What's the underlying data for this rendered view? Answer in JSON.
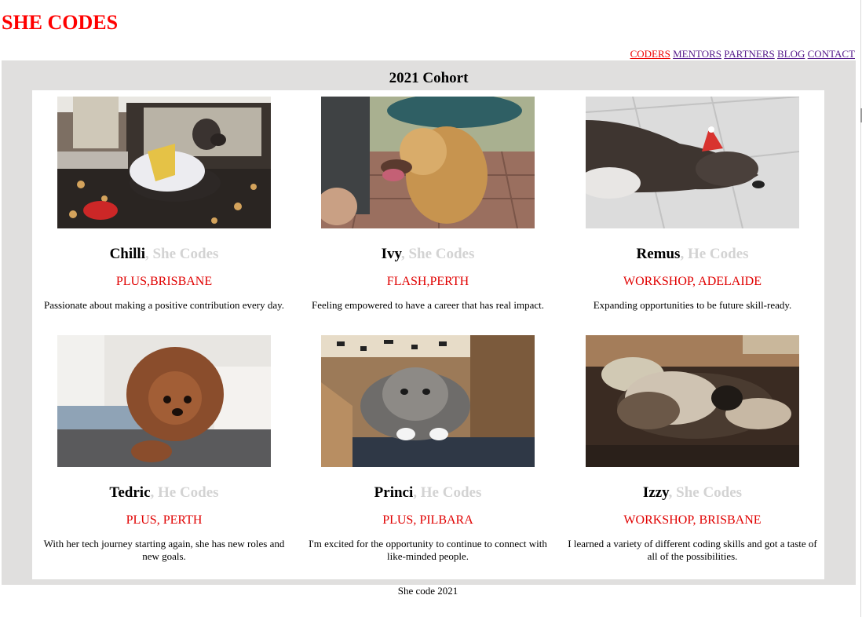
{
  "header": {
    "logo": "SHE CODES"
  },
  "nav": {
    "coders": "CODERS",
    "mentors": "MENTORS",
    "partners": "PARTNERS",
    "blog": "BLOG",
    "contact": "CONTACT"
  },
  "cohort": {
    "title": "2021 Cohort",
    "coders": [
      {
        "name": "Chilli",
        "suffix": ", She Codes",
        "location": "PLUS,BRISBANE",
        "description": "Passionate about making a positive contribution every day."
      },
      {
        "name": "Ivy",
        "suffix": ", She Codes",
        "location": "FLASH,PERTH",
        "description": "Feeling empowered to have a career that has real impact."
      },
      {
        "name": "Remus",
        "suffix": ", He Codes",
        "location": "WORKSHOP, ADELAIDE",
        "description": "Expanding opportunities to be future skill-ready."
      },
      {
        "name": "Tedric",
        "suffix": ", He Codes",
        "location": "PLUS, PERTH",
        "description": "With her tech journey starting again, she has new roles and new goals."
      },
      {
        "name": "Princi",
        "suffix": ", He Codes",
        "location": "PLUS, PILBARA",
        "description": "I'm excited for the opportunity to continue to connect with like-minded people."
      },
      {
        "name": "Izzy",
        "suffix": ", She Codes",
        "location": "WORKSHOP, BRISBANE",
        "description": "I learned a variety of different coding skills and got a taste of all of the possibilities."
      }
    ]
  },
  "footer": {
    "text": "She code 2021"
  }
}
